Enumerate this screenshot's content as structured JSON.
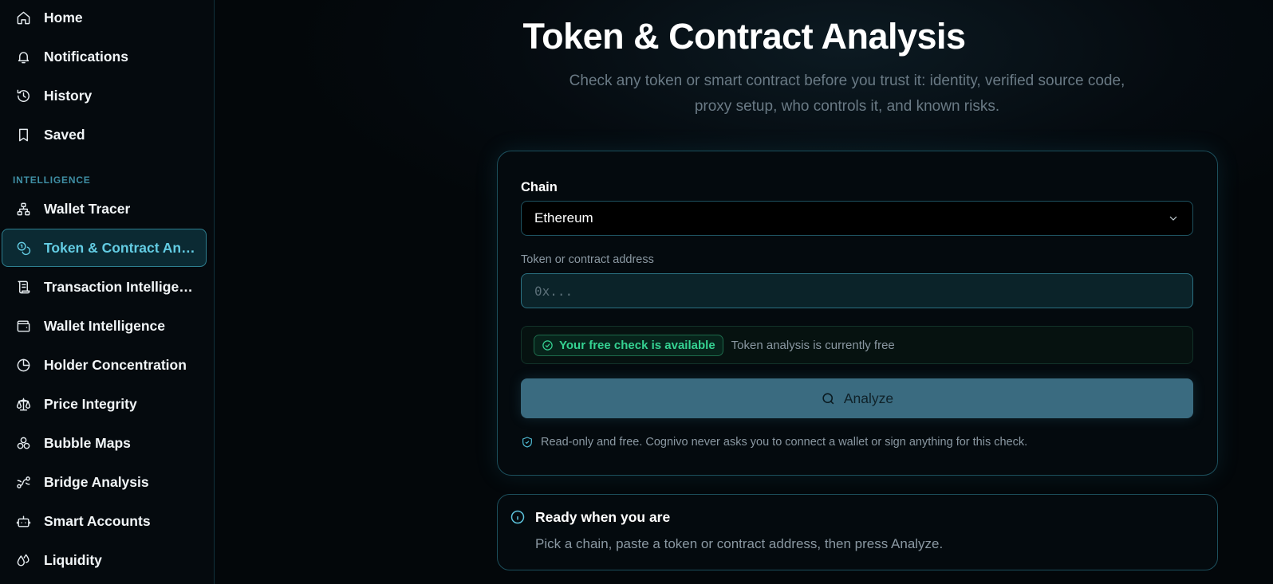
{
  "sidebar": {
    "items": [
      {
        "label": "Home",
        "icon": "home-icon"
      },
      {
        "label": "Notifications",
        "icon": "bell-icon"
      },
      {
        "label": "History",
        "icon": "history-icon"
      },
      {
        "label": "Saved",
        "icon": "bookmark-icon"
      }
    ],
    "section_label": "INTELLIGENCE",
    "intel_items": [
      {
        "label": "Wallet Tracer",
        "icon": "network-icon"
      },
      {
        "label": "Token & Contract Analysis",
        "icon": "coins-icon",
        "active": true
      },
      {
        "label": "Transaction Intelligence",
        "icon": "scroll-icon"
      },
      {
        "label": "Wallet Intelligence",
        "icon": "wallet-icon"
      },
      {
        "label": "Holder Concentration",
        "icon": "pie-chart-icon"
      },
      {
        "label": "Price Integrity",
        "icon": "scale-icon"
      },
      {
        "label": "Bubble Maps",
        "icon": "bubbles-icon"
      },
      {
        "label": "Bridge Analysis",
        "icon": "route-icon"
      },
      {
        "label": "Smart Accounts",
        "icon": "bot-icon"
      },
      {
        "label": "Liquidity",
        "icon": "droplets-icon"
      }
    ]
  },
  "main": {
    "title": "Token & Contract Analysis",
    "subtitle": "Check any token or smart contract before you trust it: identity, verified source code, proxy setup, who controls it, and known risks.",
    "form": {
      "chain_label": "Chain",
      "chain_value": "Ethereum",
      "address_label": "Token or contract address",
      "address_placeholder": "0x...",
      "address_value": "",
      "free_badge": "Your free check is available",
      "free_text": "Token analysis is currently free",
      "analyze_label": "Analyze",
      "note": "Read-only and free. Cognivo never asks you to connect a wallet or sign anything for this check."
    },
    "ready": {
      "title": "Ready when you are",
      "text": "Pick a chain, paste a token or contract address, then press Analyze."
    }
  },
  "colors": {
    "accent": "#63cce3",
    "success": "#35d292",
    "button": "#3a6b80"
  }
}
